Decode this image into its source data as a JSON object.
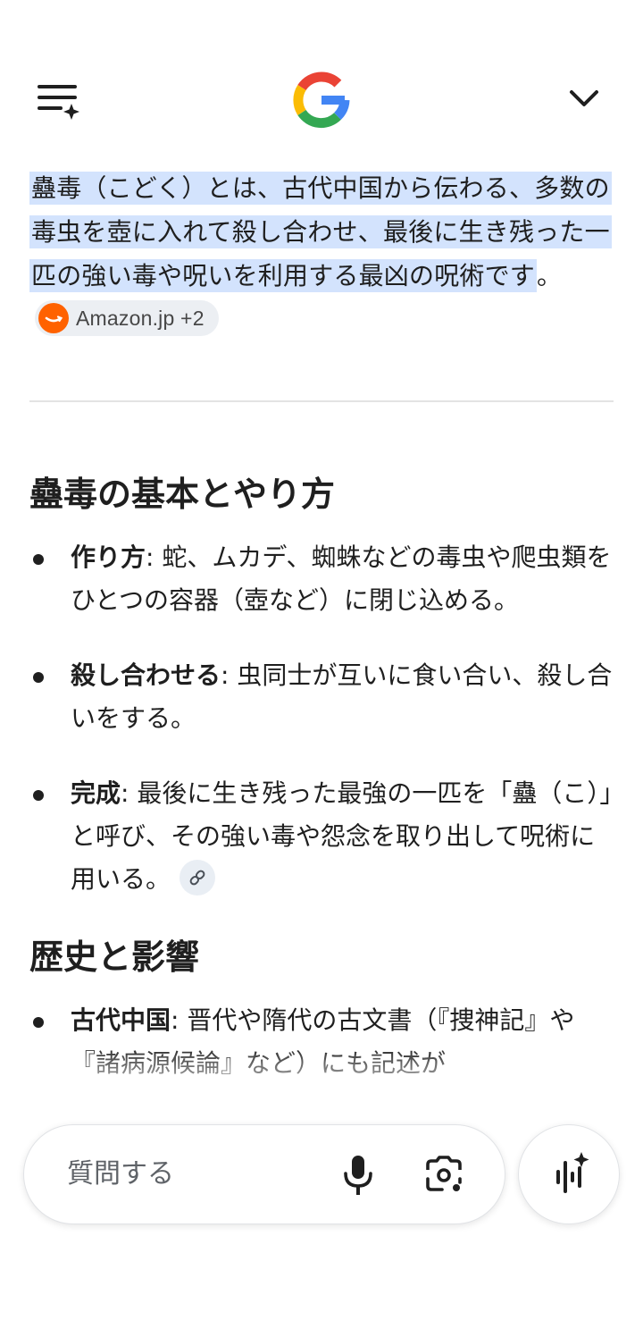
{
  "header": {
    "menu_icon": "menu-sparkle-icon",
    "logo_icon": "google-g-logo",
    "collapse_icon": "chevron-down-icon"
  },
  "answer": {
    "lead_text": "蠱毒（こどく）とは、古代中国から伝わる、多数の毒虫を壺に入れて殺し合わせ、最後に生き残った一匹の強い毒や呪いを利用する最凶の呪術です",
    "lead_end": "。",
    "source_chip": {
      "label": "Amazon.jp +2",
      "icon": "amazon-logo"
    }
  },
  "sections": [
    {
      "heading": "蠱毒の基本とやり方",
      "items": [
        {
          "term": "作り方",
          "text": ": 蛇、ムカデ、蜘蛛などの毒虫や爬虫類をひとつの容器（壺など）に閉じ込める。"
        },
        {
          "term": "殺し合わせる",
          "text": ": 虫同士が互いに食い合い、殺し合いをする。"
        },
        {
          "term": "完成",
          "text": ": 最後に生き残った最強の一匹を「蠱（こ）」と呼び、その強い毒や怨念を取り出して呪術に用いる。",
          "link_icon": "link-icon"
        }
      ]
    },
    {
      "heading": "歴史と影響",
      "items": [
        {
          "term": "古代中国",
          "text": ": 晋代や隋代の古文書（『捜神記』や『諸病源候論』など）にも記述が"
        }
      ]
    }
  ],
  "bottom": {
    "search_placeholder": "質問する",
    "mic_icon": "mic-icon",
    "lens_icon": "camera-lens-icon",
    "ai_mode_icon": "sparkle-voice-icon"
  },
  "colors": {
    "highlight": "#d3e3fd",
    "chip_bg": "#eceff3",
    "amazon": "#ff6200",
    "text": "#1f1f1f"
  }
}
